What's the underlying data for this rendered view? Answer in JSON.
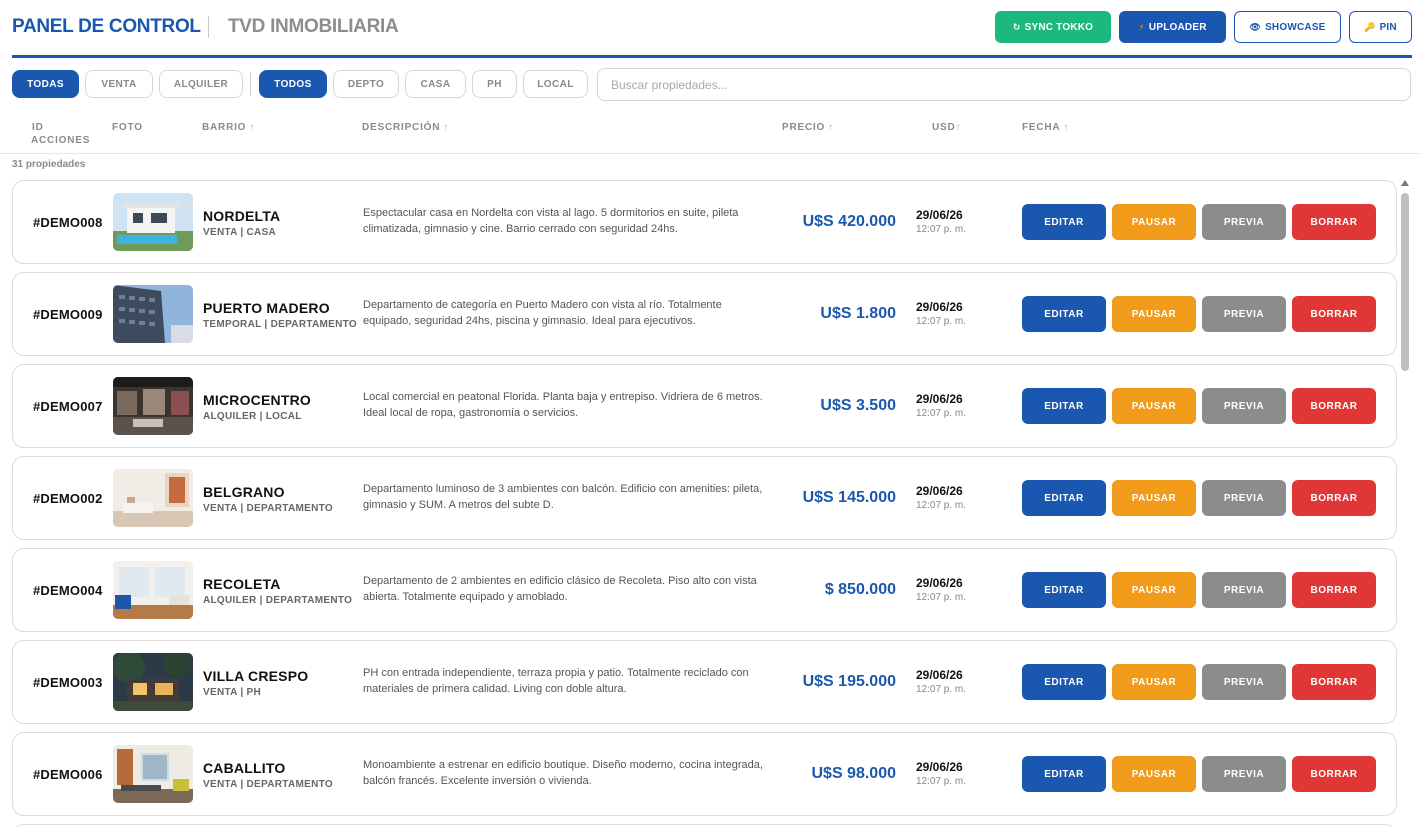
{
  "header": {
    "title": "PANEL DE CONTROL",
    "subtitle": "TVD INMOBILIARIA",
    "buttons": {
      "sync": {
        "icon": "↻",
        "label": "SYNC TOKKO"
      },
      "uploader": {
        "icon": "⚡",
        "label": "UPLOADER"
      },
      "showcase": {
        "icon": "👁",
        "label": "SHOWCASE"
      },
      "pin": {
        "icon": "🔑",
        "label": "PIN"
      }
    },
    "colors": {
      "primary": "#1a57b0",
      "sync": "#1db87e",
      "pause": "#f29a1a",
      "preview": "#8c8c8c",
      "delete": "#e03636"
    }
  },
  "filters": {
    "operation": [
      "TODAS",
      "VENTA",
      "ALQUILER"
    ],
    "operation_selected": "TODAS",
    "type": [
      "TODOS",
      "DEPTO",
      "CASA",
      "PH",
      "LOCAL"
    ],
    "type_selected": "TODOS",
    "search_placeholder": "Buscar propiedades...",
    "search_value": ""
  },
  "table": {
    "headers": {
      "id": "ID",
      "actions": "ACCIONES",
      "photo": "FOTO",
      "barrio": "BARRIO",
      "description": "DESCRIPCIÓN",
      "price": "PRECIO",
      "usd": "USD",
      "date": "FECHA"
    },
    "sort_arrow": "↑",
    "count_label": "31 propiedades",
    "action_labels": {
      "edit": "EDITAR",
      "pause": "PAUSAR",
      "preview": "PREVIA",
      "delete": "BORRAR"
    },
    "rows": [
      {
        "id": "#DEMO008",
        "barrio": "NORDELTA",
        "tipo": "VENTA | CASA",
        "description": "Espectacular casa en Nordelta con vista al lago. 5 dormitorios en suite, pileta climatizada, gimnasio y cine. Barrio cerrado con seguridad 24hs.",
        "price": "U$S 420.000",
        "date": "29/06/26",
        "time": "12:07 p. m.",
        "photo": "house-pool-photo"
      },
      {
        "id": "#DEMO009",
        "barrio": "PUERTO MADERO",
        "tipo": "TEMPORAL | DEPARTAMENTO",
        "description": "Departamento de categoría en Puerto Madero con vista al río. Totalmente equipado, seguridad 24hs, piscina y gimnasio. Ideal para ejecutivos.",
        "price": "U$S 1.800",
        "date": "29/06/26",
        "time": "12:07 p. m.",
        "photo": "tower-building-photo"
      },
      {
        "id": "#DEMO007",
        "barrio": "MICROCENTRO",
        "tipo": "ALQUILER | LOCAL",
        "description": "Local comercial en peatonal Florida. Planta baja y entrepiso. Vidriera de 6 metros. Ideal local de ropa, gastronomía o servicios.",
        "price": "U$S 3.500",
        "date": "29/06/26",
        "time": "12:07 p. m.",
        "photo": "store-interior-photo"
      },
      {
        "id": "#DEMO002",
        "barrio": "BELGRANO",
        "tipo": "VENTA | DEPARTAMENTO",
        "description": "Departamento luminoso de 3 ambientes con balcón. Edificio con amenities: pileta, gimnasio y SUM. A metros del subte D.",
        "price": "U$S 145.000",
        "date": "29/06/26",
        "time": "12:07 p. m.",
        "photo": "bright-living-photo"
      },
      {
        "id": "#DEMO004",
        "barrio": "RECOLETA",
        "tipo": "ALQUILER | DEPARTAMENTO",
        "description": "Departamento de 2 ambientes en edificio clásico de Recoleta. Piso alto con vista abierta. Totalmente equipado y amoblado.",
        "price": "$ 850.000",
        "date": "29/06/26",
        "time": "12:07 p. m.",
        "photo": "classic-living-photo"
      },
      {
        "id": "#DEMO003",
        "barrio": "VILLA CRESPO",
        "tipo": "VENTA | PH",
        "description": "PH con entrada independiente, terraza propia y patio. Totalmente reciclado con materiales de primera calidad. Living con doble altura.",
        "price": "U$S 195.000",
        "date": "29/06/26",
        "time": "12:07 p. m.",
        "photo": "night-house-photo"
      },
      {
        "id": "#DEMO006",
        "barrio": "CABALLITO",
        "tipo": "VENTA | DEPARTAMENTO",
        "description": "Monoambiente a estrenar en edificio boutique. Diseño moderno, cocina integrada, balcón francés. Excelente inversión o vivienda.",
        "price": "U$S 98.000",
        "date": "29/06/26",
        "time": "12:07 p. m.",
        "photo": "studio-interior-photo"
      }
    ]
  }
}
